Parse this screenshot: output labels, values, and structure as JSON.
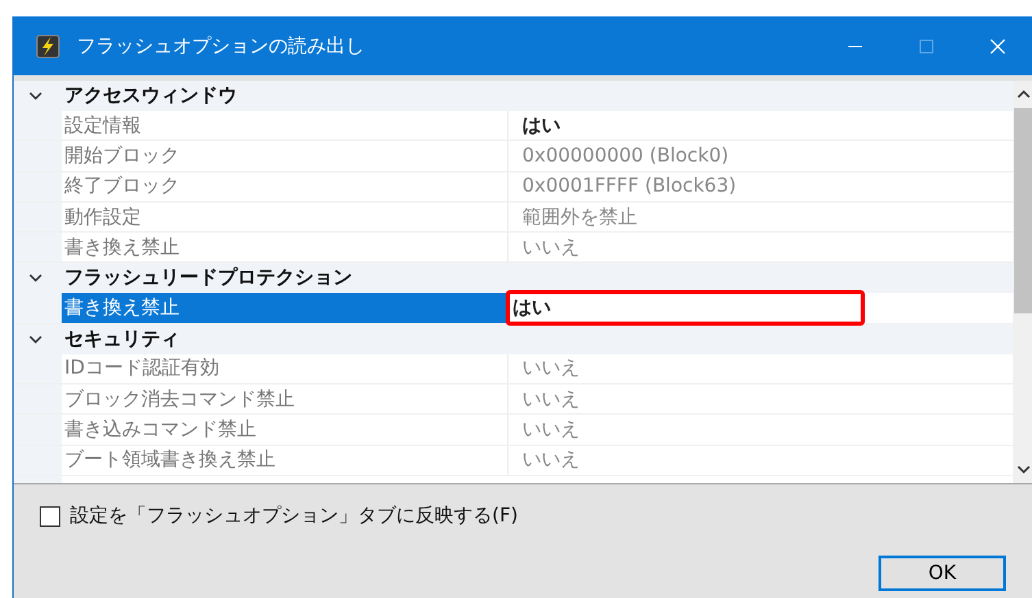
{
  "window": {
    "title": "フラッシュオプションの読み出し",
    "maximize_disabled": true
  },
  "groups": [
    {
      "title": "アクセスウィンドウ",
      "expanded": true,
      "items": [
        {
          "name": "設定情報",
          "value": "はい",
          "modified": true,
          "selected": false,
          "highlighted": false
        },
        {
          "name": "開始ブロック",
          "value": "0x00000000 (Block0)",
          "modified": false,
          "selected": false,
          "highlighted": false
        },
        {
          "name": "終了ブロック",
          "value": "0x0001FFFF (Block63)",
          "modified": false,
          "selected": false,
          "highlighted": false
        },
        {
          "name": "動作設定",
          "value": "範囲外を禁止",
          "modified": false,
          "selected": false,
          "highlighted": false
        },
        {
          "name": "書き換え禁止",
          "value": "いいえ",
          "modified": false,
          "selected": false,
          "highlighted": false
        }
      ]
    },
    {
      "title": "フラッシュリードプロテクション",
      "expanded": true,
      "items": [
        {
          "name": "書き換え禁止",
          "value": "はい",
          "modified": true,
          "selected": true,
          "highlighted": true
        }
      ]
    },
    {
      "title": "セキュリティ",
      "expanded": true,
      "items": [
        {
          "name": "IDコード認証有効",
          "value": "いいえ",
          "modified": false,
          "selected": false,
          "highlighted": false
        },
        {
          "name": "ブロック消去コマンド禁止",
          "value": "いいえ",
          "modified": false,
          "selected": false,
          "highlighted": false
        },
        {
          "name": "書き込みコマンド禁止",
          "value": "いいえ",
          "modified": false,
          "selected": false,
          "highlighted": false
        },
        {
          "name": "ブート領域書き換え禁止",
          "value": "いいえ",
          "modified": false,
          "selected": false,
          "highlighted": false
        }
      ]
    }
  ],
  "apply_checkbox": {
    "label": "設定を「フラッシュオプション」タブに反映する(F)",
    "checked": false
  },
  "buttons": [
    "OK"
  ]
}
